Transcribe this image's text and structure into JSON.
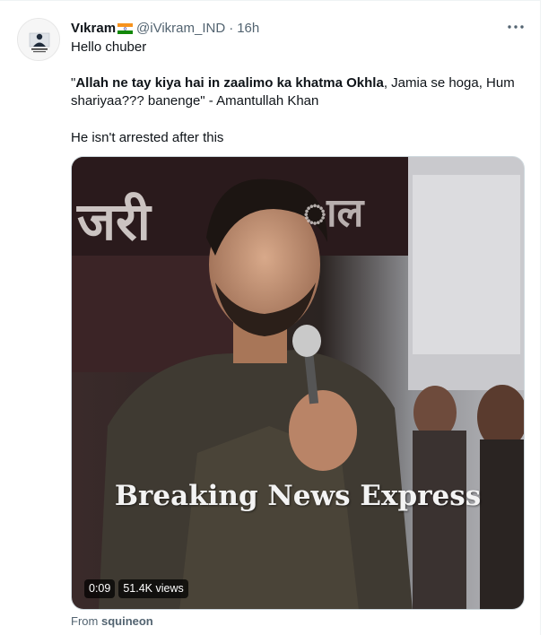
{
  "tweet": {
    "author_name": "Vıkram",
    "flag_icon": "india-flag-icon",
    "handle": "@iVikram_IND",
    "separator": "·",
    "time": "16h",
    "more_icon": "more-horizontal-icon",
    "line1": "Hello chuber",
    "quote_open": "\"",
    "quote_bold": "Allah ne tay kiya hai in zaalimo ka khatma Okhla",
    "quote_rest_line1": ", Jamia se hoga, Hum",
    "quote_line2": "shariyaa??? banenge\" - Amantullah Khan",
    "line3": "He isn't arrested after this"
  },
  "media": {
    "video_time": "0:09",
    "views": "51.4K views",
    "watermark": "Breaking News Express",
    "banner_text": "जरी",
    "banner_text2": "ाल"
  },
  "source": {
    "prefix": "From",
    "account": "squineon"
  },
  "colors": {
    "text_primary": "#0f1419",
    "text_secondary": "#536471",
    "border": "#cfd9de"
  }
}
